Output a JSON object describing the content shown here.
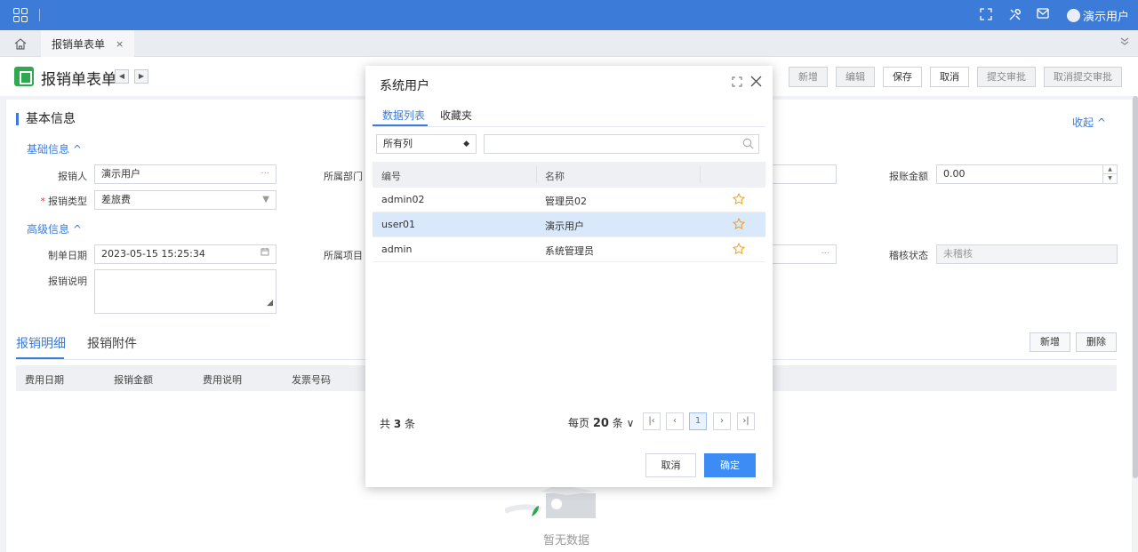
{
  "topbar": {
    "user_name": "演示用户"
  },
  "tabstrip": {
    "tab_label": "报销单表单",
    "close_glyph": "×"
  },
  "pagehead": {
    "title": "报销单表单"
  },
  "toolbar": {
    "add": "新增",
    "edit": "编辑",
    "save": "保存",
    "cancel": "取消",
    "submit": "提交审批",
    "cancel_submit": "取消提交审批"
  },
  "form": {
    "section_title": "基本信息",
    "collapse_label": "收起 ^",
    "basic_group": "基础信息 ^",
    "advanced_group": "高级信息 ^",
    "applicant_label": "报销人",
    "applicant_value": "演示用户",
    "dept_label": "所属部门",
    "amount_label": "报账金额",
    "amount_value": "0.00",
    "type_label": "报销类型",
    "type_value": "差旅费",
    "date_label": "制单日期",
    "date_value": "2023-05-15 15:25:34",
    "project_label": "所属项目",
    "audit_label": "稽核状态",
    "audit_value": "未稽核",
    "note_label": "报销说明"
  },
  "details": {
    "tab_detail": "报销明细",
    "tab_attach": "报销附件",
    "add": "新增",
    "delete": "删除",
    "columns": [
      "费用日期",
      "报销金额",
      "费用说明",
      "发票号码"
    ],
    "empty_text": "暂无数据"
  },
  "dialog": {
    "title": "系统用户",
    "tabs": [
      "数据列表",
      "收藏夹"
    ],
    "filter_value": "所有列",
    "search_placeholder": "",
    "columns": [
      "编号",
      "名称"
    ],
    "rows": [
      {
        "code": "admin02",
        "name": "管理员02",
        "selected": false
      },
      {
        "code": "user01",
        "name": "演示用户",
        "selected": true
      },
      {
        "code": "admin",
        "name": "系统管理员",
        "selected": false
      }
    ],
    "total_prefix": "共 ",
    "total_count": "3",
    "total_suffix": " 条",
    "page_size_prefix": "每页 ",
    "page_size": "20",
    "page_size_suffix": " 条",
    "current_page": "1",
    "cancel_label": "取消",
    "ok_label": "确定"
  },
  "colors": {
    "primary": "#3d7bd9",
    "selected_row": "#dae8fb",
    "star": "#f0a020",
    "required": "#e4393c"
  }
}
